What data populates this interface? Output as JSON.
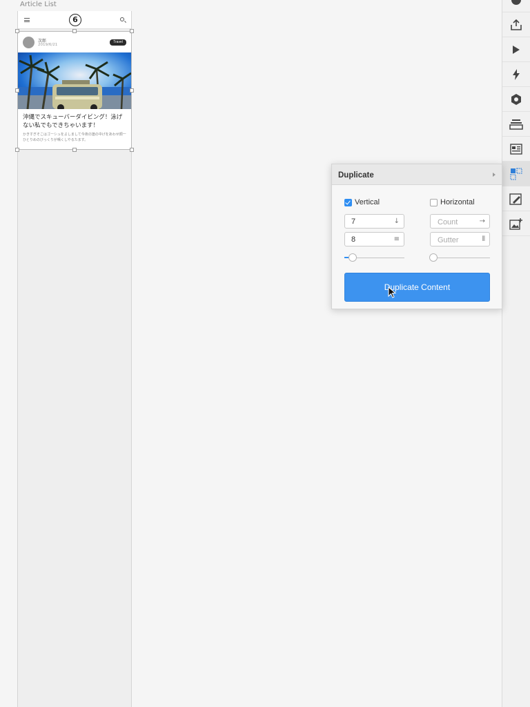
{
  "artboard": {
    "label": "Article List",
    "header": {
      "logo_text": "6"
    },
    "card": {
      "author": "次郎",
      "date": "2019/6/21",
      "tag": "Travel",
      "title": "沖縄でスキューバーダイビング！泳げない私でもできちゃいます！",
      "excerpt": "かきすぎそこはゴーシュをよしまして今夜の譜の中げをあわせ顔一ひとりめのびっくりが鳴くしやるたます。"
    }
  },
  "toolbar": {
    "items": [
      {
        "name": "pie-chart-icon",
        "active": false
      },
      {
        "name": "upload-icon",
        "active": false
      },
      {
        "name": "play-icon",
        "active": false
      },
      {
        "name": "lightning-icon",
        "active": false
      },
      {
        "name": "hexagon-icon",
        "active": false
      },
      {
        "name": "stack-icon",
        "active": false
      },
      {
        "name": "text-layout-icon",
        "active": false
      },
      {
        "name": "duplicate-grid-icon",
        "active": true
      },
      {
        "name": "image-edit-icon",
        "active": false
      },
      {
        "name": "add-image-icon",
        "active": false
      }
    ]
  },
  "panel": {
    "title": "Duplicate",
    "vertical": {
      "label": "Vertical",
      "checked": true,
      "count": "7",
      "gutter": "8",
      "slider_value": 0.12
    },
    "horizontal": {
      "label": "Horizontal",
      "checked": false,
      "count_placeholder": "Count",
      "gutter_placeholder": "Gutter",
      "slider_value": 0
    },
    "button_label": "Duplicate Content",
    "colors": {
      "accent": "#3d93ef"
    }
  }
}
